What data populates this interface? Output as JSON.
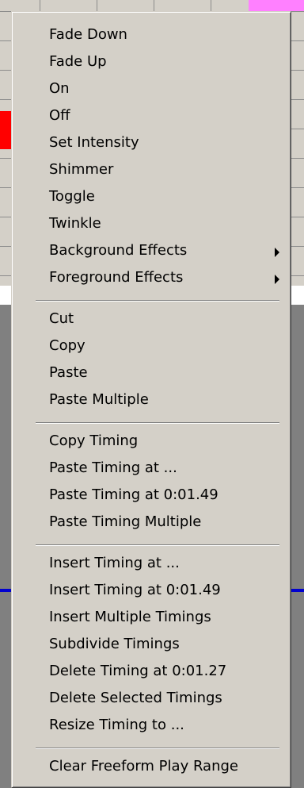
{
  "menu": {
    "groups": [
      {
        "items": [
          {
            "label": "Fade Down"
          },
          {
            "label": "Fade Up"
          },
          {
            "label": "On"
          },
          {
            "label": "Off"
          },
          {
            "label": "Set Intensity"
          },
          {
            "label": "Shimmer"
          },
          {
            "label": "Toggle"
          },
          {
            "label": "Twinkle"
          },
          {
            "label": "Background Effects",
            "submenu": true
          },
          {
            "label": "Foreground Effects",
            "submenu": true
          }
        ]
      },
      {
        "items": [
          {
            "label": "Cut"
          },
          {
            "label": "Copy"
          },
          {
            "label": "Paste"
          },
          {
            "label": "Paste Multiple"
          }
        ]
      },
      {
        "items": [
          {
            "label": "Copy Timing"
          },
          {
            "label": "Paste Timing at ..."
          },
          {
            "label": "Paste Timing at 0:01.49"
          },
          {
            "label": "Paste Timing Multiple"
          }
        ]
      },
      {
        "items": [
          {
            "label": "Insert Timing at ..."
          },
          {
            "label": "Insert Timing at 0:01.49"
          },
          {
            "label": "Insert Multiple Timings"
          },
          {
            "label": "Subdivide Timings"
          },
          {
            "label": "Delete Timing at 0:01.27"
          },
          {
            "label": "Delete Selected Timings"
          },
          {
            "label": "Resize Timing to ..."
          }
        ]
      },
      {
        "items": [
          {
            "label": "Clear Freeform Play Range"
          }
        ]
      }
    ]
  },
  "colors": {
    "menu_bg": "#d4d0c8",
    "timeline_red": "#ff0000",
    "timeline_pink": "#ff80ff",
    "timeline_blue": "#0000d0",
    "workspace_gray": "#808080"
  },
  "icons": {
    "submenu": "submenu-arrow-icon"
  }
}
